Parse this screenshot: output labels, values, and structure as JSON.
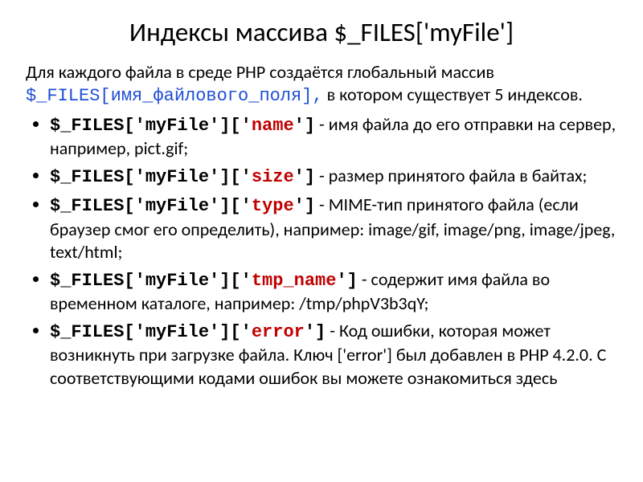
{
  "title": "Индексы массива $_FILES['myFile']",
  "intro": {
    "part1": "Для каждого файла в среде PHP создаётся глобальный массив ",
    "code": "$_FILES[имя_файлового_поля],",
    "part2": " в котором существует 5 индексов."
  },
  "items": [
    {
      "prefix": "$_FILES['myFile']['",
      "key": "name",
      "suffix": "']",
      "desc": "  - имя файла до его отправки на сервер, например, pict.gif;"
    },
    {
      "prefix": "$_FILES['myFile']['",
      "key": "size",
      "suffix": "']",
      "desc": "  - размер принятого файла в байтах;"
    },
    {
      "prefix": "$_FILES['myFile']['",
      "key": "type",
      "suffix": "']",
      "desc": "  - MIME-тип принятого файла (если браузер смог его определить), например: image/gif, image/png, image/jpeg, text/html;"
    },
    {
      "prefix": "$_FILES['myFile']['",
      "key": "tmp_name",
      "suffix": "']",
      "desc": "  - содержит имя файла во временном каталоге, например: /tmp/phpV3b3qY;"
    },
    {
      "prefix": "$_FILES['myFile']['",
      "key": "error",
      "suffix": "']",
      "desc": " - Код ошибки, которая может возникнуть при загрузке файла. Ключ ['error'] был добавлен в PHP 4.2.0. С соответствующими кодами ошибок вы можете ознакомиться здесь"
    }
  ]
}
